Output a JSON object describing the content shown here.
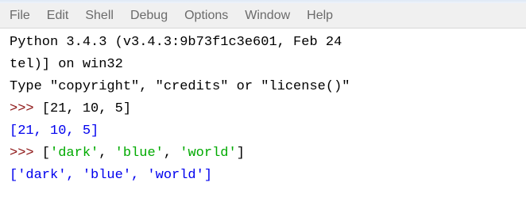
{
  "menu": [
    {
      "label": "File"
    },
    {
      "label": "Edit"
    },
    {
      "label": "Shell"
    },
    {
      "label": "Debug"
    },
    {
      "label": "Options"
    },
    {
      "label": "Window"
    },
    {
      "label": "Help"
    }
  ],
  "shell": {
    "banner": [
      "Python 3.4.3 (v3.4.3:9b73f1c3e601, Feb 24",
      "tel)] on win32",
      "Type \"copyright\", \"credits\" or \"license()\""
    ],
    "prompt": ">>>",
    "input1": " [21, 10, 5]",
    "output1": "[21, 10, 5]",
    "input2": {
      "open": " [",
      "items": [
        "'dark'",
        "'blue'",
        "'world'"
      ],
      "sep": ", ",
      "close": "]"
    },
    "output2": "['dark', 'blue', 'world']"
  },
  "colors": {
    "prompt": "#8b1111",
    "output": "#0000ee",
    "string": "#00aa00",
    "text": "#000000",
    "menu_text": "#6b6b6b"
  }
}
